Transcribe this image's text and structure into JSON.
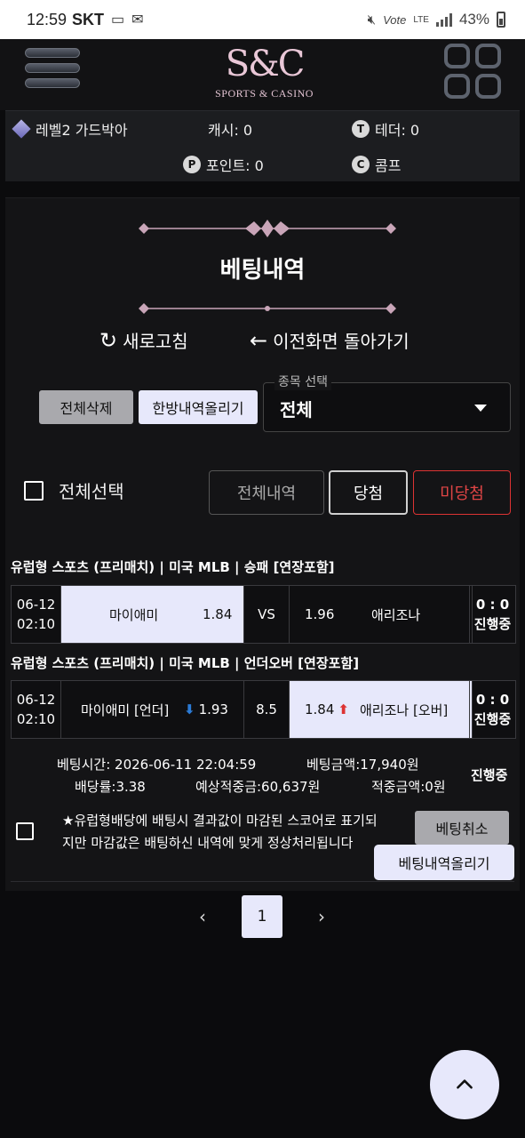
{
  "status_bar": {
    "time": "12:59",
    "carrier": "SKT",
    "network": "Vote",
    "lte": "LTE",
    "battery": "43%"
  },
  "header": {
    "logo_mark": "S&C",
    "logo_sub": "SPORTS & CASINO"
  },
  "user_info": {
    "level": "레벨2 가드박아",
    "cash": "캐시: 0",
    "tether": "테더: 0",
    "point": "포인트: 0",
    "comp": "콤프"
  },
  "page": {
    "title": "베팅내역",
    "refresh": "새로고침",
    "back": "이전화면 돌아가기",
    "delete_all": "전체삭제",
    "upload_all": "한방내역올리기",
    "select_label": "종목 선택",
    "select_value": "전체",
    "select_all": "전체선택",
    "tab_all": "전체내역",
    "tab_won": "당첨",
    "tab_pending": "미당첨"
  },
  "bets": [
    {
      "label": "유럽형 스포츠 (프리매치) | 미국 MLB | 승패 [연장포함]",
      "date": "06-12",
      "time": "02:10",
      "home": "마이애미",
      "home_odds": "1.84",
      "middle": "VS",
      "away_odds": "1.96",
      "away": "애리조나",
      "score": "0 : 0",
      "status": "진행중"
    },
    {
      "label": "유럽형 스포츠 (프리매치) | 미국 MLB | 언더오버 [연장포함]",
      "date": "06-12",
      "time": "02:10",
      "home": "마이애미 [언더]",
      "home_odds": "1.93",
      "middle": "8.5",
      "away_odds": "1.84",
      "away": "애리조나 [오버]",
      "score": "0 : 0",
      "status": "진행중"
    }
  ],
  "summary": {
    "bet_time": "베팅시간: 2026-06-11 22:04:59",
    "bet_amount": "베팅금액:17,940원",
    "odds": "배당률:3.38",
    "expected": "예상적중금:60,637원",
    "won_amount": "적중금액:0원",
    "status": "진행중",
    "note": "★유럽형배당에 배팅시 결과값이 마감된 스코어로 표기되지만 마감값은 배팅하신 내역에 맞게 정상처리됩니다",
    "cancel": "베팅취소",
    "upload": "베팅내역올리기"
  },
  "pagination": {
    "prev": "‹",
    "current": "1",
    "next": "›"
  },
  "colors": {
    "accent_light": "#e7e8fb",
    "pending_red": "#d33",
    "down_blue": "#2b7bd6"
  }
}
